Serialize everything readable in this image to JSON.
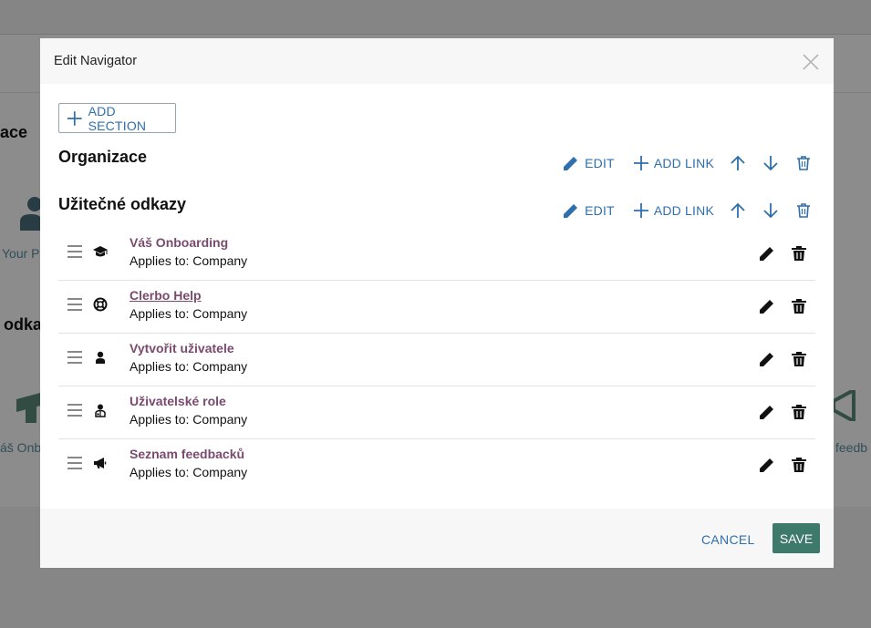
{
  "modal": {
    "title": "Edit Navigator",
    "add_section_label": "ADD SECTION",
    "cancel_label": "CANCEL",
    "save_label": "SAVE"
  },
  "sections": [
    {
      "title": "Organizace",
      "edit_label": "EDIT",
      "add_link_label": "ADD LINK"
    },
    {
      "title": "Užitečné odkazy",
      "edit_label": "EDIT",
      "add_link_label": "ADD LINK"
    }
  ],
  "links": [
    {
      "name": "Váš Onboarding",
      "applies": "Applies to: Company",
      "icon": "graduation-cap-icon"
    },
    {
      "name": "Clerbo Help",
      "applies": "Applies to: Company",
      "icon": "lifebuoy-icon"
    },
    {
      "name": "Vytvořit uživatele",
      "applies": "Applies to: Company",
      "icon": "user-icon"
    },
    {
      "name": "Uživatelské role",
      "applies": "Applies to: Company",
      "icon": "user-role-icon"
    },
    {
      "name": "Seznam feedbacků",
      "applies": "Applies to: Company",
      "icon": "megaphone-icon"
    }
  ],
  "background": {
    "heading_1": "ace",
    "caption_1": "Your P",
    "heading_2": "odka",
    "caption_2": "áš Onbo",
    "caption_3": "feedb"
  },
  "colors": {
    "accent": "#2f6fad",
    "link": "#7a4a6e",
    "save": "#3d7a6c"
  }
}
